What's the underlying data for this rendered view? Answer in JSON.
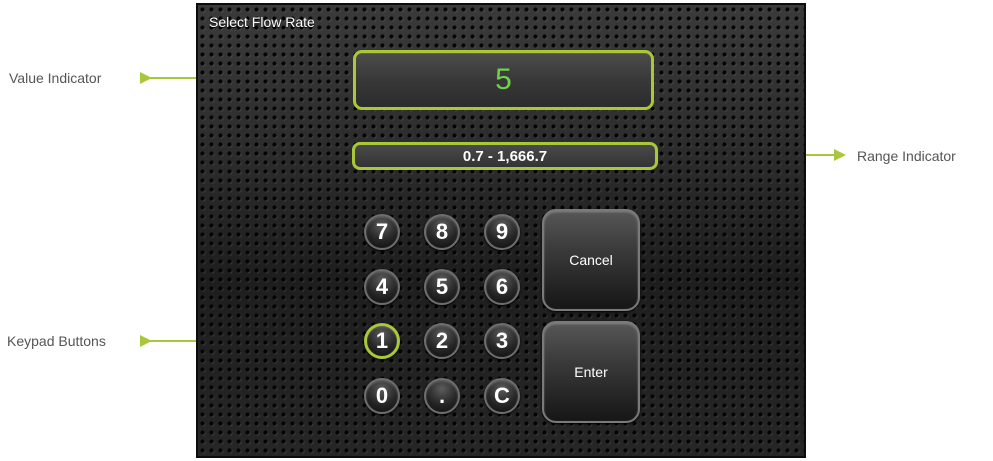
{
  "panel": {
    "title": "Select Flow Rate"
  },
  "value_indicator": {
    "value": "5"
  },
  "range_indicator": {
    "text": "0.7 - 1,666.7"
  },
  "keypad": {
    "keys": [
      "7",
      "8",
      "9",
      "4",
      "5",
      "6",
      "1",
      "2",
      "3",
      "0",
      ".",
      "C"
    ],
    "cancel_label": "Cancel",
    "enter_label": "Enter"
  },
  "callouts": {
    "value_indicator": "Value Indicator",
    "range_indicator": "Range Indicator",
    "keypad_buttons": "Keypad Buttons"
  },
  "colors": {
    "highlight": "#a8c83a",
    "value_text": "#6fd04a"
  }
}
